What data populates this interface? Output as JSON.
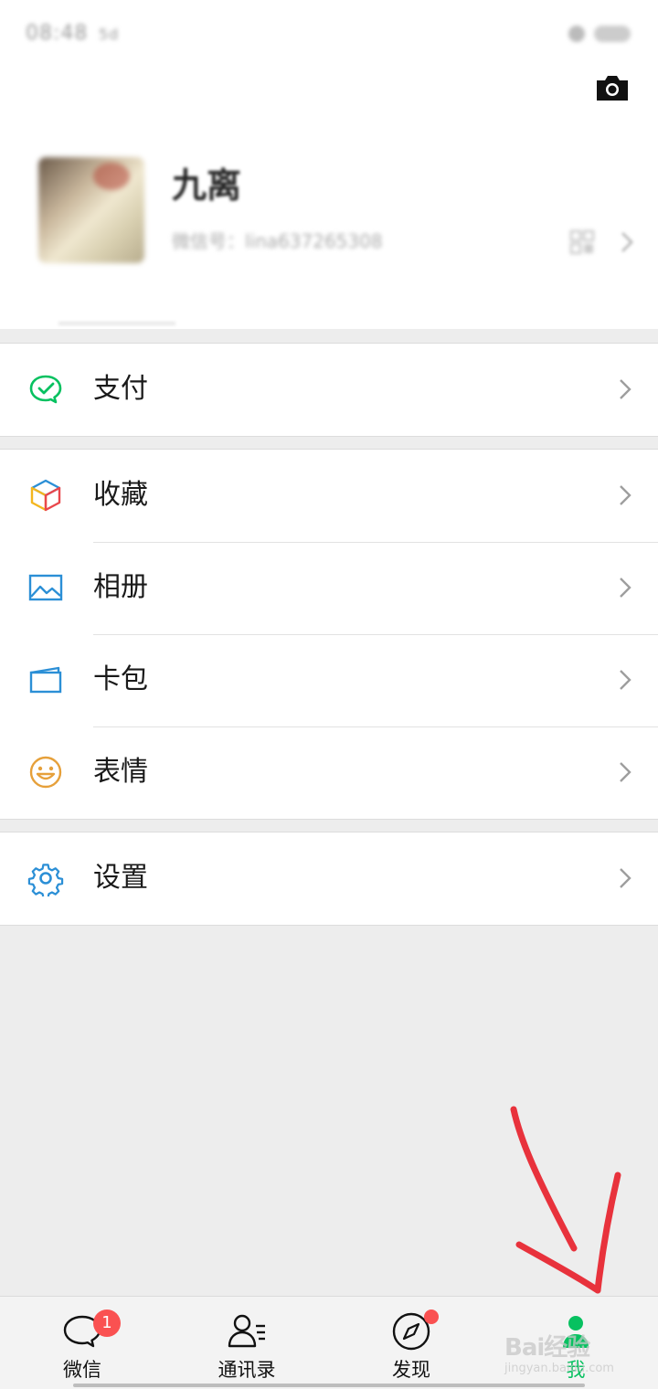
{
  "status_bar": {
    "time": "08:48",
    "signal": "5d"
  },
  "profile": {
    "nickname": "九离",
    "wechat_id": "微信号：lina637265308"
  },
  "menu": {
    "pay": "支付",
    "favorites": "收藏",
    "album": "相册",
    "cards": "卡包",
    "stickers": "表情",
    "settings": "设置"
  },
  "tabbar": {
    "chats": {
      "label": "微信",
      "badge": "1"
    },
    "contacts": {
      "label": "通讯录"
    },
    "discover": {
      "label": "发现"
    },
    "me": {
      "label": "我"
    }
  },
  "watermark": {
    "main": "Bai经验",
    "sub": "jingyan.baidu.com"
  },
  "colors": {
    "accent": "#07c160",
    "badge": "#fa5151",
    "annotation": "#e8323c"
  }
}
